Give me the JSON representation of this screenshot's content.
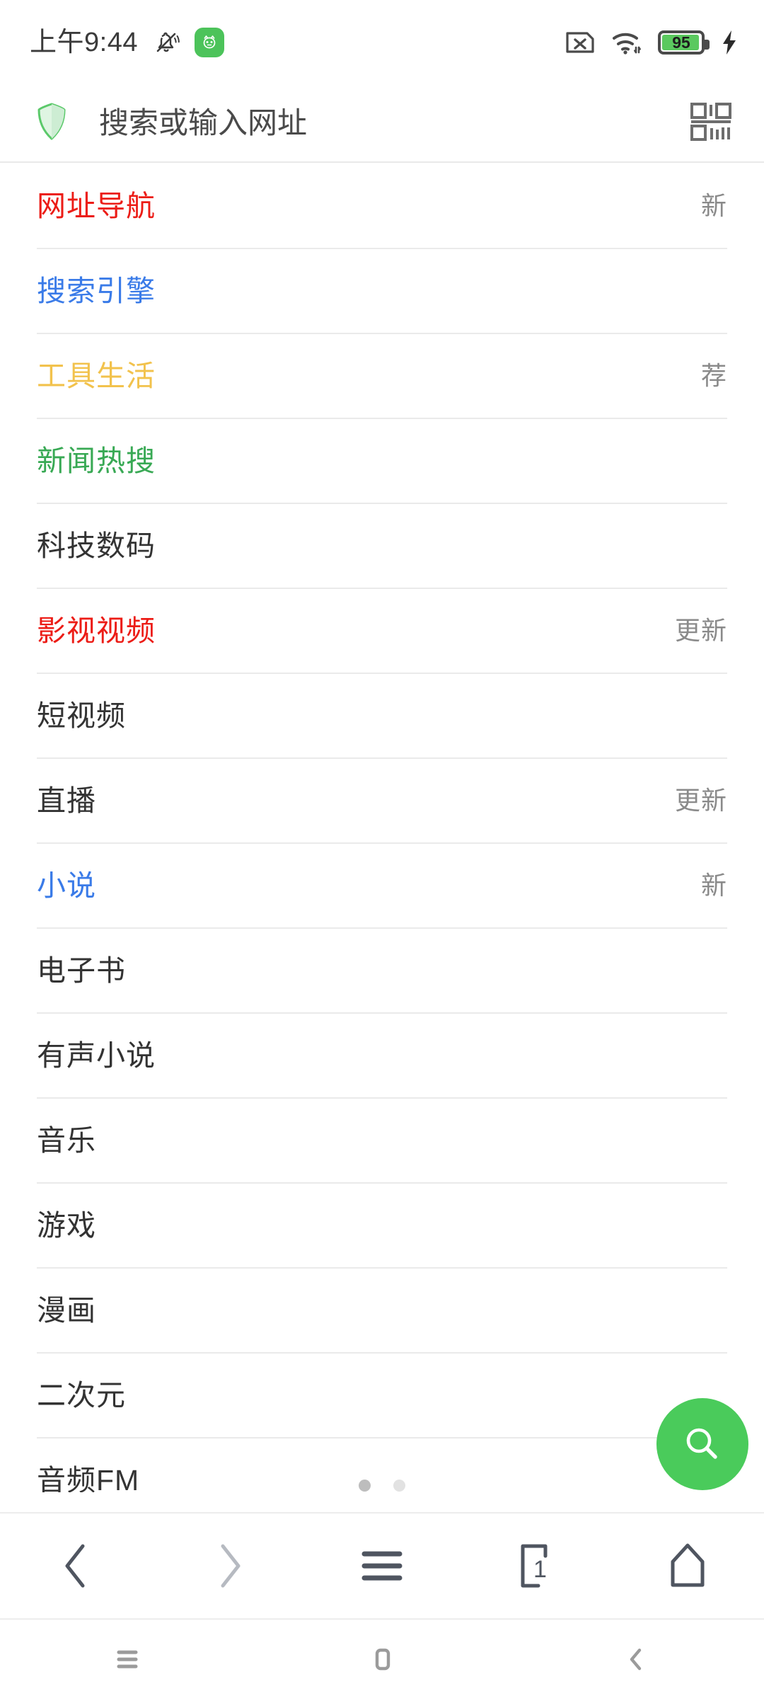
{
  "status_bar": {
    "time": "上午9:44",
    "mute_icon": "bell-muted-icon",
    "app_badge_icon": "green-app-icon",
    "sim_icon": "sim-card-no-service-icon",
    "wifi_icon": "wifi-icon",
    "battery_level": "95",
    "battery_color": "#5BC95F",
    "charging_icon": "lightning-bolt-icon"
  },
  "search": {
    "placeholder": "搜索或输入网址",
    "shield_icon": "shield-icon",
    "shield_color": "#5BC96A",
    "qr_icon": "qr-scan-icon"
  },
  "categories": [
    {
      "label": "网址导航",
      "badge": "新",
      "color": "#EC1C16"
    },
    {
      "label": "搜索引擎",
      "badge": "",
      "color": "#3A7BE8"
    },
    {
      "label": "工具生活",
      "badge": "荐",
      "color": "#F2C24C"
    },
    {
      "label": "新闻热搜",
      "badge": "",
      "color": "#38A954"
    },
    {
      "label": "科技数码",
      "badge": "",
      "color": "#333333"
    },
    {
      "label": "影视视频",
      "badge": "更新",
      "color": "#EC1C16"
    },
    {
      "label": "短视频",
      "badge": "",
      "color": "#333333"
    },
    {
      "label": "直播",
      "badge": "更新",
      "color": "#333333"
    },
    {
      "label": "小说",
      "badge": "新",
      "color": "#3A7BE8"
    },
    {
      "label": "电子书",
      "badge": "",
      "color": "#333333"
    },
    {
      "label": "有声小说",
      "badge": "",
      "color": "#333333"
    },
    {
      "label": "音乐",
      "badge": "",
      "color": "#333333"
    },
    {
      "label": "游戏",
      "badge": "",
      "color": "#333333"
    },
    {
      "label": "漫画",
      "badge": "",
      "color": "#333333"
    },
    {
      "label": "二次元",
      "badge": "",
      "color": "#333333"
    },
    {
      "label": "音频FM",
      "badge": "",
      "color": "#333333"
    }
  ],
  "pager": {
    "total": 2,
    "active_index": 0
  },
  "fab": {
    "icon": "search-icon",
    "color": "#4ACB5B"
  },
  "toolbar": {
    "back_label": "back-icon",
    "forward_label": "forward-icon",
    "menu_label": "menu-icon",
    "tabs_label": "tabs-icon",
    "tab_count": "1",
    "home_label": "home-icon"
  },
  "android_nav": {
    "recents_label": "recents-icon",
    "home_label": "home-icon",
    "back_label": "back-icon"
  }
}
